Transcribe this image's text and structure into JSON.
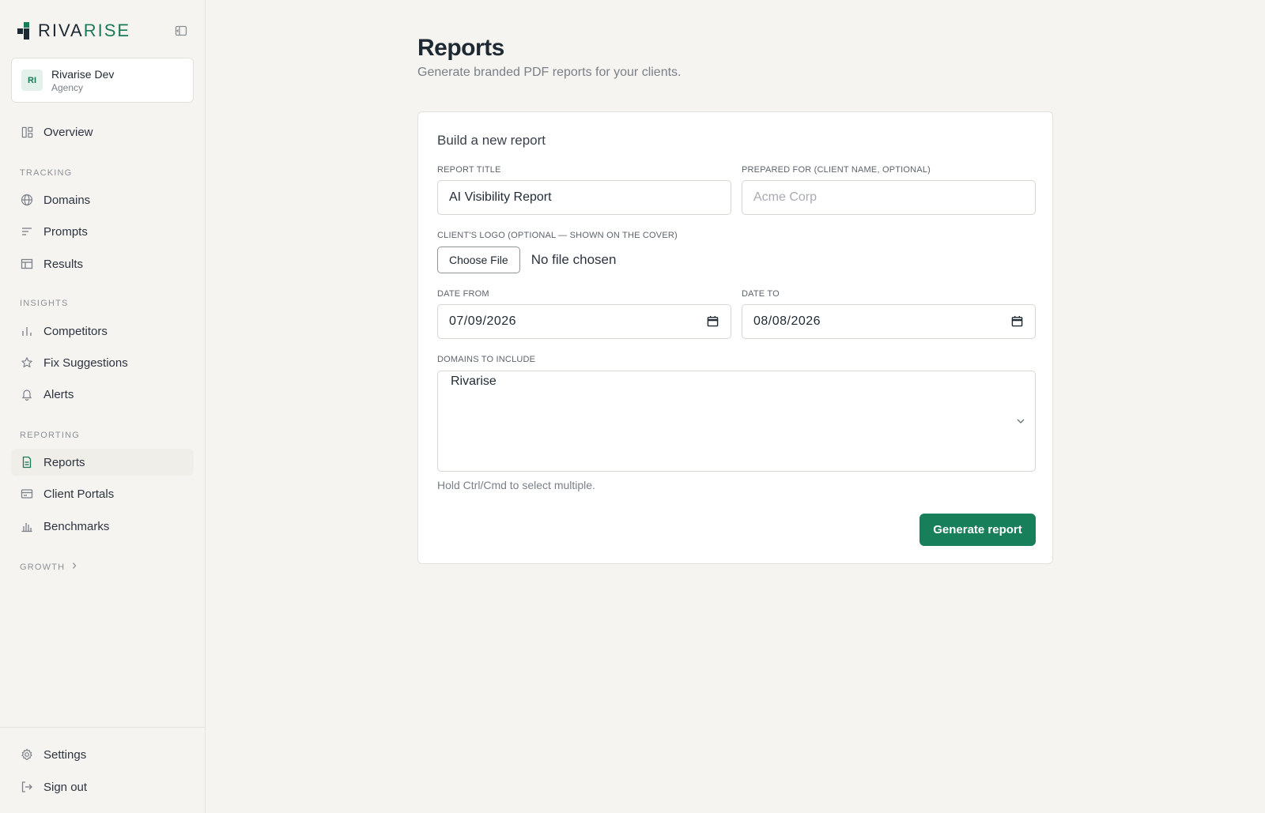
{
  "brand": {
    "name_part1": "RIVA",
    "name_part2": "RISE",
    "accent_color": "#1a7a5a"
  },
  "account": {
    "initials": "RI",
    "name": "Rivarise Dev",
    "role": "Agency"
  },
  "sidebar": {
    "overview": {
      "label": "Overview",
      "icon": "dashboard-icon"
    },
    "sections": {
      "tracking": "TRACKING",
      "insights": "INSIGHTS",
      "reporting": "REPORTING",
      "growth": "GROWTH"
    },
    "items": [
      {
        "label": "Domains",
        "icon": "globe-icon"
      },
      {
        "label": "Prompts",
        "icon": "lines-icon"
      },
      {
        "label": "Results",
        "icon": "table-icon"
      },
      {
        "label": "Competitors",
        "icon": "bar-chart-icon"
      },
      {
        "label": "Fix Suggestions",
        "icon": "star-icon"
      },
      {
        "label": "Alerts",
        "icon": "bell-icon"
      },
      {
        "label": "Reports",
        "icon": "document-icon",
        "active": true
      },
      {
        "label": "Client Portals",
        "icon": "card-icon"
      },
      {
        "label": "Benchmarks",
        "icon": "bar-chart-icon"
      }
    ],
    "settings": "Settings",
    "signout": "Sign out"
  },
  "page": {
    "title": "Reports",
    "subtitle": "Generate branded PDF reports for your clients."
  },
  "form": {
    "card_title": "Build a new report",
    "report_title_label": "REPORT TITLE",
    "report_title_value": "AI Visibility Report",
    "prepared_for_label": "PREPARED FOR (CLIENT NAME, OPTIONAL)",
    "prepared_for_placeholder": "Acme Corp",
    "logo_label": "CLIENT'S LOGO (OPTIONAL — SHOWN ON THE COVER)",
    "choose_file": "Choose File",
    "file_status": "No file chosen",
    "date_from_label": "DATE FROM",
    "date_from_value": "07/09/2026",
    "date_to_label": "DATE TO",
    "date_to_value": "08/08/2026",
    "domains_label": "DOMAINS TO INCLUDE",
    "domains_options": [
      "Rivarise"
    ],
    "domains_first": "Rivarise",
    "hint": "Hold Ctrl/Cmd to select multiple.",
    "submit": "Generate report",
    "button_color": "#17805b"
  }
}
